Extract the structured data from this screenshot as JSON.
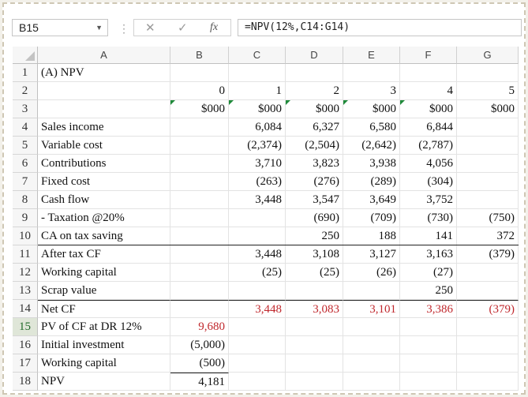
{
  "name_box": "B15",
  "formula": "=NPV(12%,C14:G14)",
  "formula_bar": {
    "cancel_glyph": "✕",
    "enter_glyph": "✓",
    "fx_label": "fx",
    "more_glyph": "⋮",
    "dropdown_glyph": "▼"
  },
  "columns": [
    "A",
    "B",
    "C",
    "D",
    "E",
    "F",
    "G"
  ],
  "rows": [
    {
      "n": "1",
      "cells": [
        "(A) NPV",
        "",
        "",
        "",
        "",
        "",
        ""
      ]
    },
    {
      "n": "2",
      "cells": [
        "",
        "0",
        "1",
        "2",
        "3",
        "4",
        "5"
      ]
    },
    {
      "n": "3",
      "cells": [
        "",
        "$000",
        "$000",
        "$000",
        "$000",
        "$000",
        "$000"
      ]
    },
    {
      "n": "4",
      "cells": [
        "Sales income",
        "",
        "6,084",
        "6,327",
        "6,580",
        "6,844",
        ""
      ]
    },
    {
      "n": "5",
      "cells": [
        "Variable cost",
        "",
        "(2,374)",
        "(2,504)",
        "(2,642)",
        "(2,787)",
        ""
      ]
    },
    {
      "n": "6",
      "cells": [
        "Contributions",
        "",
        "3,710",
        "3,823",
        "3,938",
        "4,056",
        ""
      ]
    },
    {
      "n": "7",
      "cells": [
        "Fixed cost",
        "",
        "(263)",
        "(276)",
        "(289)",
        "(304)",
        ""
      ]
    },
    {
      "n": "8",
      "cells": [
        "Cash flow",
        "",
        "3,448",
        "3,547",
        "3,649",
        "3,752",
        ""
      ]
    },
    {
      "n": "9",
      "cells": [
        "- Taxation @20%",
        "",
        "",
        "(690)",
        "(709)",
        "(730)",
        "(750)"
      ]
    },
    {
      "n": "10",
      "cells": [
        "CA on tax saving",
        "",
        "",
        "250",
        "188",
        "141",
        "372"
      ]
    },
    {
      "n": "11",
      "cells": [
        "After tax CF",
        "",
        "3,448",
        "3,108",
        "3,127",
        "3,163",
        "(379)"
      ]
    },
    {
      "n": "12",
      "cells": [
        "Working capital",
        "",
        "(25)",
        "(25)",
        "(26)",
        "(27)",
        ""
      ]
    },
    {
      "n": "13",
      "cells": [
        "Scrap value",
        "",
        "",
        "",
        "",
        "250",
        ""
      ]
    },
    {
      "n": "14",
      "cells": [
        "Net CF",
        "",
        "3,448",
        "3,083",
        "3,101",
        "3,386",
        "(379)"
      ]
    },
    {
      "n": "15",
      "cells": [
        "PV of CF at DR 12%",
        "9,680",
        "",
        "",
        "",
        "",
        ""
      ]
    },
    {
      "n": "16",
      "cells": [
        "Initial investment",
        "(5,000)",
        "",
        "",
        "",
        "",
        ""
      ]
    },
    {
      "n": "17",
      "cells": [
        "Working capital",
        "(500)",
        "",
        "",
        "",
        "",
        ""
      ]
    },
    {
      "n": "18",
      "cells": [
        "NPV",
        "4,181",
        "",
        "",
        "",
        "",
        ""
      ]
    }
  ],
  "colors": {
    "negative_red": "#c0282d",
    "selected_row_header": "#216a2a",
    "triangle_marker": "#1f8a3a"
  }
}
